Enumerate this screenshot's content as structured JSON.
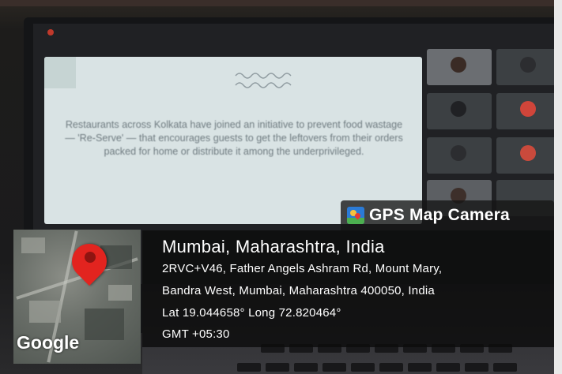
{
  "meeting": {
    "slide_text": "Restaurants across Kolkata have joined an initiative to prevent food wastage — 'Re-Serve' — that encourages guests to get the leftovers from their orders packed for home or distribute it among the underprivileged."
  },
  "gps_overlay": {
    "app_name": "GPS Map Camera",
    "location_title": "Mumbai, Maharashtra, India",
    "address_line_1": "2RVC+V46, Father Angels Ashram Rd, Mount Mary,",
    "address_line_2": "Bandra West, Mumbai, Maharashtra 400050, India",
    "coordinates": "Lat 19.044658° Long 72.820464°",
    "timezone": "GMT +05:30",
    "map_provider": "Google"
  },
  "colors": {
    "pin_red": "#e2241f",
    "overlay_bg": "#0c0c0c",
    "slide_bg": "#d9e3e4",
    "meet_bg": "#202124"
  }
}
